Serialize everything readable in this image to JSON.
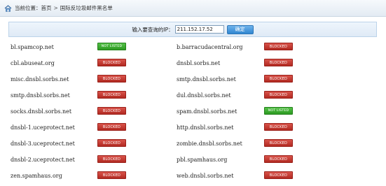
{
  "breadcrumb": {
    "prefix": "当前位置：",
    "home": "首页",
    "separator": ">",
    "current": "国际反垃圾邮件黑名单"
  },
  "query": {
    "label": "输入要查询的IP：",
    "ip_value": "211.152.17.52",
    "button_label": "确定"
  },
  "colors": {
    "blocked": "#c0392b",
    "not_listed": "#3aaa2e",
    "panel_border": "#bcd3ea"
  },
  "rows": [
    {
      "left": {
        "host": "bl.spamcop.net",
        "status": "NOT LISTED",
        "kind": "notlisted"
      },
      "right": {
        "host": "b.barracudacentral.org",
        "status": "BLOCKED",
        "kind": "blocked"
      }
    },
    {
      "left": {
        "host": "cbl.abuseat.org",
        "status": "BLOCKED",
        "kind": "blocked"
      },
      "right": {
        "host": "dnsbl.sorbs.net",
        "status": "BLOCKED",
        "kind": "blocked"
      }
    },
    {
      "left": {
        "host": "misc.dnsbl.sorbs.net",
        "status": "BLOCKED",
        "kind": "blocked"
      },
      "right": {
        "host": "smtp.dnsbl.sorbs.net",
        "status": "BLOCKED",
        "kind": "blocked"
      }
    },
    {
      "left": {
        "host": "smtp.dnsbl.sorbs.net",
        "status": "BLOCKED",
        "kind": "blocked"
      },
      "right": {
        "host": "dul.dnsbl.sorbs.net",
        "status": "BLOCKED",
        "kind": "blocked"
      }
    },
    {
      "left": {
        "host": "socks.dnsbl.sorbs.net",
        "status": "BLOCKED",
        "kind": "blocked"
      },
      "right": {
        "host": "spam.dnsbl.sorbs.net",
        "status": "NOT LISTED",
        "kind": "notlisted"
      }
    },
    {
      "left": {
        "host": "dnsbl-1.uceprotect.net",
        "status": "BLOCKED",
        "kind": "blocked"
      },
      "right": {
        "host": "http.dnsbl.sorbs.net",
        "status": "BLOCKED",
        "kind": "blocked"
      }
    },
    {
      "left": {
        "host": "dnsbl-3.uceprotect.net",
        "status": "BLOCKED",
        "kind": "blocked"
      },
      "right": {
        "host": "zombie.dnsbl.sorbs.net",
        "status": "BLOCKED",
        "kind": "blocked"
      }
    },
    {
      "left": {
        "host": "dnsbl-2.uceprotect.net",
        "status": "BLOCKED",
        "kind": "blocked"
      },
      "right": {
        "host": "pbl.spamhaus.org",
        "status": "BLOCKED",
        "kind": "blocked"
      }
    },
    {
      "left": {
        "host": "zen.spamhaus.org",
        "status": "BLOCKED",
        "kind": "blocked"
      },
      "right": {
        "host": "web.dnsbl.sorbs.net",
        "status": "BLOCKED",
        "kind": "blocked"
      }
    }
  ]
}
